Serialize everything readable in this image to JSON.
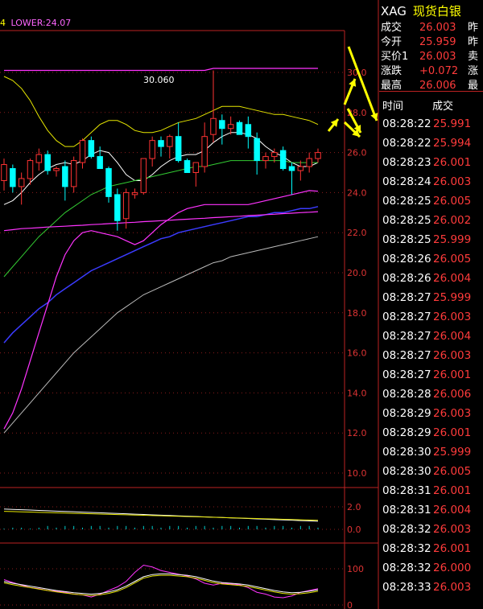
{
  "indicator_header": {
    "prefix": "4",
    "lower_label": "LOWER:24.07"
  },
  "chart": {
    "max_label": "30.060",
    "y_ticks": [
      "30.0",
      "28.0",
      "26.0",
      "24.0",
      "22.0",
      "20.0",
      "18.0",
      "16.0",
      "14.0",
      "12.0",
      "10.0"
    ],
    "macd_ticks": [
      "2.0",
      "0.0"
    ],
    "kdj_ticks": [
      "100",
      "0"
    ]
  },
  "chart_data": {
    "type": "candlestick",
    "ylim": [
      10.0,
      31.5
    ],
    "candles": [
      [
        24.6,
        25.7,
        24.1,
        25.4
      ],
      [
        25.2,
        25.4,
        24.0,
        24.3
      ],
      [
        24.3,
        25.0,
        23.4,
        24.7
      ],
      [
        24.7,
        25.7,
        24.4,
        25.6
      ],
      [
        25.5,
        26.2,
        25.1,
        25.9
      ],
      [
        25.9,
        26.1,
        24.9,
        25.1
      ],
      [
        25.1,
        25.3,
        24.8,
        25.2
      ],
      [
        25.3,
        25.6,
        23.6,
        24.3
      ],
      [
        24.3,
        25.8,
        24.0,
        25.6
      ],
      [
        25.5,
        26.7,
        25.2,
        26.6
      ],
      [
        26.6,
        26.8,
        25.7,
        25.8
      ],
      [
        25.8,
        26.3,
        25.4,
        25.2
      ],
      [
        25.2,
        25.3,
        23.5,
        23.8
      ],
      [
        23.9,
        24.2,
        22.1,
        22.6
      ],
      [
        22.7,
        24.2,
        22.2,
        24.0
      ],
      [
        23.9,
        24.2,
        23.7,
        24.0
      ],
      [
        24.0,
        25.7,
        23.9,
        25.7
      ],
      [
        25.7,
        26.8,
        25.3,
        26.6
      ],
      [
        26.6,
        26.8,
        25.8,
        26.3
      ],
      [
        26.3,
        26.9,
        25.7,
        26.8
      ],
      [
        26.8,
        27.5,
        25.5,
        25.6
      ],
      [
        25.6,
        25.7,
        25.1,
        25.0
      ],
      [
        25.0,
        25.5,
        24.3,
        25.5
      ],
      [
        25.3,
        27.5,
        25.0,
        26.8
      ],
      [
        26.9,
        30.1,
        26.5,
        27.7
      ],
      [
        27.6,
        27.9,
        26.4,
        27.2
      ],
      [
        27.2,
        27.8,
        26.9,
        27.4
      ],
      [
        27.5,
        27.6,
        26.9,
        26.9
      ],
      [
        27.4,
        27.8,
        26.2,
        26.8
      ],
      [
        26.7,
        27.0,
        24.9,
        25.6
      ],
      [
        25.6,
        26.0,
        25.2,
        25.8
      ],
      [
        25.8,
        26.2,
        25.5,
        26.0
      ],
      [
        26.1,
        26.3,
        25.1,
        25.2
      ],
      [
        25.3,
        25.5,
        23.9,
        25.1
      ],
      [
        25.1,
        25.6,
        24.6,
        25.3
      ],
      [
        25.3,
        26.0,
        25.0,
        25.7
      ],
      [
        25.7,
        26.2,
        25.5,
        26.0
      ]
    ],
    "series": [
      {
        "values": [
          23.4,
          23.6,
          24.0,
          24.5,
          24.9,
          25.2,
          25.4,
          25.5,
          25.4,
          25.6,
          25.9,
          26.1,
          26.0,
          25.5,
          24.9,
          24.6,
          24.6,
          24.9,
          25.3,
          25.6,
          25.8,
          25.9,
          25.9,
          26.1,
          26.5,
          26.8,
          27.0,
          27.0,
          26.9,
          26.7,
          26.3,
          26.0,
          25.8,
          25.5,
          25.3,
          25.3,
          25.5
        ]
      },
      {
        "values": [
          19.8,
          20.3,
          20.8,
          21.3,
          21.8,
          22.2,
          22.6,
          23.0,
          23.3,
          23.6,
          23.9,
          24.1,
          24.3,
          24.4,
          24.5,
          24.6,
          24.7,
          24.8,
          24.9,
          25.0,
          25.1,
          25.2,
          25.3,
          25.3,
          25.4,
          25.5,
          25.6,
          25.6,
          25.6,
          25.6,
          25.6,
          25.6,
          25.6,
          25.5,
          25.5,
          25.5,
          25.5
        ]
      },
      {
        "values": [
          16.5,
          17.0,
          17.4,
          17.8,
          18.2,
          18.5,
          18.9,
          19.2,
          19.5,
          19.8,
          20.1,
          20.3,
          20.5,
          20.7,
          20.9,
          21.1,
          21.3,
          21.5,
          21.7,
          21.8,
          22.0,
          22.1,
          22.2,
          22.3,
          22.4,
          22.5,
          22.6,
          22.7,
          22.8,
          22.8,
          22.9,
          23.0,
          23.0,
          23.1,
          23.2,
          23.2,
          23.3
        ]
      },
      {
        "values": [
          12.0,
          12.5,
          13.0,
          13.5,
          14.0,
          14.5,
          15.0,
          15.5,
          16.0,
          16.4,
          16.8,
          17.2,
          17.6,
          18.0,
          18.3,
          18.6,
          18.9,
          19.1,
          19.3,
          19.5,
          19.7,
          19.9,
          20.1,
          20.3,
          20.5,
          20.6,
          20.8,
          20.9,
          21.0,
          21.1,
          21.2,
          21.3,
          21.4,
          21.5,
          21.6,
          21.7,
          21.8
        ]
      },
      {
        "values": [
          15.8,
          16.0,
          16.2,
          16.4,
          16.6,
          16.7,
          16.9,
          17.0,
          17.1,
          17.2,
          17.3,
          17.4,
          17.5,
          17.6,
          17.7,
          17.8,
          17.9,
          18.0,
          18.1,
          18.2,
          18.3,
          18.4,
          18.5,
          18.6,
          18.7,
          18.8,
          18.9,
          19.0,
          19.1,
          19.2,
          19.3,
          19.4,
          19.5,
          19.5,
          19.6,
          19.7,
          19.8
        ]
      },
      {
        "values": [
          22.1,
          22.15,
          22.2,
          22.22,
          22.25,
          22.28,
          22.3,
          22.32,
          22.35,
          22.37,
          22.4,
          22.42,
          22.45,
          22.47,
          22.5,
          22.52,
          22.55,
          22.57,
          22.6,
          22.62,
          22.65,
          22.67,
          22.7,
          22.72,
          22.75,
          22.77,
          22.8,
          22.82,
          22.85,
          22.87,
          22.9,
          22.92,
          22.95,
          22.97,
          23.0,
          23.02,
          23.05
        ]
      },
      {
        "values": [
          30.1,
          30.1,
          30.1,
          30.1,
          30.1,
          30.1,
          30.1,
          30.1,
          30.1,
          30.1,
          30.1,
          30.1,
          30.1,
          30.1,
          30.1,
          30.1,
          30.1,
          30.1,
          30.1,
          30.1,
          30.1,
          30.1,
          30.1,
          30.1,
          30.2,
          30.2,
          30.2,
          30.2,
          30.2,
          30.2,
          30.2,
          30.2,
          30.2,
          30.2,
          30.2,
          30.2,
          30.2
        ]
      },
      {
        "values": [
          29.8,
          29.6,
          29.2,
          28.6,
          27.8,
          27.1,
          26.6,
          26.3,
          26.3,
          26.6,
          27.0,
          27.4,
          27.6,
          27.6,
          27.4,
          27.1,
          27.0,
          27.0,
          27.1,
          27.3,
          27.5,
          27.6,
          27.7,
          27.9,
          28.1,
          28.3,
          28.3,
          28.3,
          28.2,
          28.1,
          28.0,
          27.9,
          27.9,
          27.8,
          27.7,
          27.6,
          27.4
        ]
      },
      {
        "values": [
          12.2,
          13.0,
          14.2,
          15.6,
          17.0,
          18.4,
          19.8,
          20.9,
          21.6,
          22.0,
          22.1,
          22.0,
          21.9,
          21.8,
          21.6,
          21.4,
          21.6,
          22.0,
          22.4,
          22.7,
          23.0,
          23.2,
          23.3,
          23.4,
          23.4,
          23.4,
          23.4,
          23.4,
          23.4,
          23.5,
          23.6,
          23.7,
          23.8,
          23.9,
          24.0,
          24.1,
          24.07
        ]
      }
    ]
  },
  "side_panel": {
    "code": "XAG",
    "name": "现货白银",
    "quote_rows": [
      {
        "label": "成交",
        "value": "26.003",
        "extra": "昨"
      },
      {
        "label": "今开",
        "value": "25.959",
        "extra": "昨"
      },
      {
        "label": "买价1",
        "value": "26.003",
        "extra": "卖"
      },
      {
        "label": "涨跌",
        "value": "+0.072",
        "extra": "涨"
      },
      {
        "label": "最高",
        "value": "26.006",
        "extra": "最"
      }
    ],
    "header_time": "时间",
    "header_deal": "成交",
    "ticks": [
      {
        "time": "08:28:22",
        "price": "25.991"
      },
      {
        "time": "08:28:22",
        "price": "25.994"
      },
      {
        "time": "08:28:23",
        "price": "26.001"
      },
      {
        "time": "08:28:24",
        "price": "26.003"
      },
      {
        "time": "08:28:25",
        "price": "26.005"
      },
      {
        "time": "08:28:25",
        "price": "26.002"
      },
      {
        "time": "08:28:25",
        "price": "25.999"
      },
      {
        "time": "08:28:26",
        "price": "26.005"
      },
      {
        "time": "08:28:26",
        "price": "26.004"
      },
      {
        "time": "08:28:27",
        "price": "25.999"
      },
      {
        "time": "08:28:27",
        "price": "26.003"
      },
      {
        "time": "08:28:27",
        "price": "26.004"
      },
      {
        "time": "08:28:27",
        "price": "26.003"
      },
      {
        "time": "08:28:27",
        "price": "26.001"
      },
      {
        "time": "08:28:28",
        "price": "26.006"
      },
      {
        "time": "08:28:29",
        "price": "26.003"
      },
      {
        "time": "08:28:29",
        "price": "26.001"
      },
      {
        "time": "08:28:30",
        "price": "25.999"
      },
      {
        "time": "08:28:30",
        "price": "26.005"
      },
      {
        "time": "08:28:31",
        "price": "26.001"
      },
      {
        "time": "08:28:31",
        "price": "26.004"
      },
      {
        "time": "08:28:32",
        "price": "26.003"
      },
      {
        "time": "08:28:32",
        "price": "26.001"
      },
      {
        "time": "08:28:32",
        "price": "26.000"
      },
      {
        "time": "08:28:33",
        "price": "26.003"
      }
    ]
  }
}
